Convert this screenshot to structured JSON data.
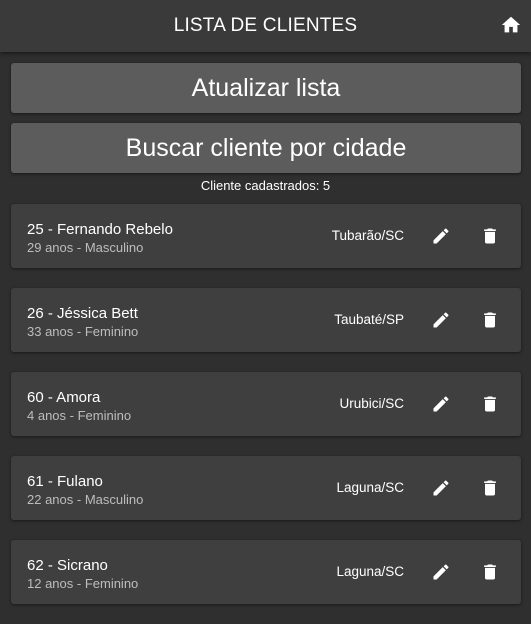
{
  "header": {
    "title": "LISTA DE CLIENTES",
    "home_icon": "home-icon"
  },
  "actions": {
    "refresh_label": "Atualizar lista",
    "search_city_label": "Buscar cliente por cidade"
  },
  "summary": {
    "count_text": "Cliente cadastrados: 5"
  },
  "clients": [
    {
      "title": "25 - Fernando Rebelo",
      "details": "29 anos - Masculino",
      "city": "Tubarão/SC"
    },
    {
      "title": "26 - Jéssica Bett",
      "details": "33 anos - Feminino",
      "city": "Taubaté/SP"
    },
    {
      "title": "60 - Amora",
      "details": "4 anos - Feminino",
      "city": "Urubici/SC"
    },
    {
      "title": "61 - Fulano",
      "details": "22 anos - Masculino",
      "city": "Laguna/SC"
    },
    {
      "title": "62 - Sicrano",
      "details": "12 anos - Feminino",
      "city": "Laguna/SC"
    }
  ],
  "icons": {
    "edit": "pencil-icon",
    "delete": "trash-icon"
  },
  "colors": {
    "background": "#2f2f2f",
    "header": "#3a3a3a",
    "button": "#5c5c5c",
    "card": "#3f3f3f",
    "secondary_text": "#bdbdbd"
  }
}
